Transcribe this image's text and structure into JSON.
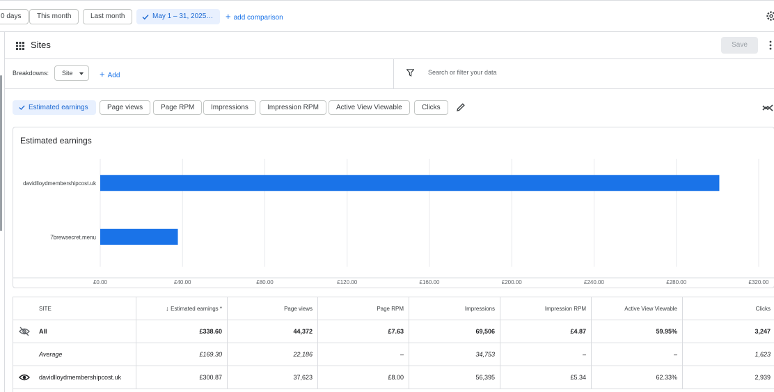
{
  "datebar": {
    "chips": [
      "0 days",
      "This month",
      "Last month"
    ],
    "active_range": "May 1 – 31, 2025…",
    "add_comparison": "add comparison"
  },
  "card": {
    "title": "Sites",
    "save_label": "Save"
  },
  "breakdowns": {
    "label": "Breakdowns:",
    "selected": "Site",
    "add_label": "Add",
    "filter_placeholder": "Search or filter your data"
  },
  "metrics": {
    "active": "Estimated earnings",
    "items": [
      "Page views",
      "Page RPM",
      "Impressions",
      "Impression RPM",
      "Active View Viewable",
      "Clicks"
    ]
  },
  "chart_data": {
    "type": "bar",
    "orientation": "horizontal",
    "title": "Estimated earnings",
    "categories": [
      "davidlloydmembershipcost.uk",
      "7brewsecret.menu"
    ],
    "values": [
      300.87,
      37.73
    ],
    "xlim": [
      0,
      320
    ],
    "x_ticks": [
      "£0.00",
      "£40.00",
      "£80.00",
      "£120.00",
      "£160.00",
      "£200.00",
      "£240.00",
      "£280.00",
      "£320.00"
    ],
    "bar_color": "#1a73e8",
    "grid": true
  },
  "table": {
    "headers": [
      "SITE",
      "Estimated earnings *",
      "Page views",
      "Page RPM",
      "Impressions",
      "Impression RPM",
      "Active View Viewable",
      "Clicks"
    ],
    "rows": [
      {
        "site": "All",
        "earnings": "£338.60",
        "page_views": "44,372",
        "page_rpm": "£7.63",
        "impressions": "69,506",
        "impression_rpm": "£4.87",
        "viewable": "59.95%",
        "clicks": "3,247"
      },
      {
        "site": "Average",
        "earnings": "£169.30",
        "page_views": "22,186",
        "page_rpm": "–",
        "impressions": "34,753",
        "impression_rpm": "–",
        "viewable": "–",
        "clicks": "1,623"
      },
      {
        "site": "davidlloydmembershipcost.uk",
        "earnings": "£300.87",
        "page_views": "37,623",
        "page_rpm": "£8.00",
        "impressions": "56,395",
        "impression_rpm": "£5.34",
        "viewable": "62.33%",
        "clicks": "2,939"
      }
    ]
  },
  "colors": {
    "accent": "#1a73e8",
    "active_chip_bg": "#e8f0fe"
  }
}
